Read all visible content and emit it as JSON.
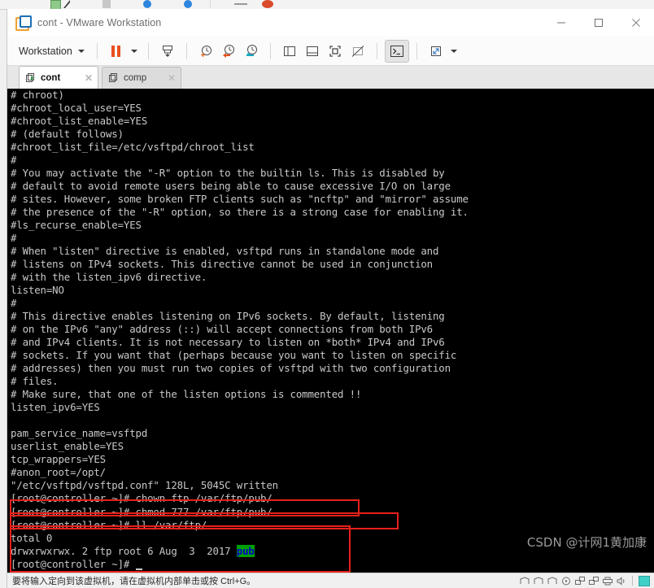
{
  "window": {
    "title": "cont - VMware Workstation",
    "app_icon": "vmware-logo-icon",
    "minimize_label": "Minimize",
    "maximize_label": "Maximize",
    "close_label": "Close"
  },
  "toolbar": {
    "menu_label": "Workstation",
    "items": [
      {
        "name": "pause-vm-button",
        "label": "Pause"
      },
      {
        "name": "pause-dropdown-button",
        "label": "Pause options"
      },
      {
        "name": "take-snapshot-button",
        "label": "Take snapshot"
      },
      {
        "name": "snapshot-manager-button",
        "label": "Snapshot"
      },
      {
        "name": "revert-snapshot-button",
        "label": "Revert to snapshot"
      },
      {
        "name": "manage-snapshots-button",
        "label": "Manage snapshots"
      },
      {
        "name": "show-library-button",
        "label": "Show or hide the library"
      },
      {
        "name": "show-console-view-button",
        "label": "Show or hide console view"
      },
      {
        "name": "show-thumbnails-button",
        "label": "Show or hide thumbnails"
      },
      {
        "name": "hide-thumbnails-button",
        "label": "Hide thumbnail bar"
      },
      {
        "name": "send-ctrl-alt-del-button",
        "label": "Send Ctrl+Alt+Del"
      },
      {
        "name": "fullscreen-button",
        "label": "Enter full screen"
      },
      {
        "name": "fullscreen-dropdown-button",
        "label": "Full screen options"
      }
    ]
  },
  "tabs": [
    {
      "label": "cont",
      "selected": true,
      "close_label": "✕",
      "icon": "vm-running-icon"
    },
    {
      "label": "comp",
      "selected": false,
      "close_label": "✕",
      "icon": "vm-stopped-icon"
    }
  ],
  "terminal": {
    "lines": [
      "# chroot)",
      "#chroot_local_user=YES",
      "#chroot_list_enable=YES",
      "# (default follows)",
      "#chroot_list_file=/etc/vsftpd/chroot_list",
      "#",
      "# You may activate the \"-R\" option to the builtin ls. This is disabled by",
      "# default to avoid remote users being able to cause excessive I/O on large",
      "# sites. However, some broken FTP clients such as \"ncftp\" and \"mirror\" assume",
      "# the presence of the \"-R\" option, so there is a strong case for enabling it.",
      "#ls_recurse_enable=YES",
      "#",
      "# When \"listen\" directive is enabled, vsftpd runs in standalone mode and",
      "# listens on IPv4 sockets. This directive cannot be used in conjunction",
      "# with the listen_ipv6 directive.",
      "listen=NO",
      "#",
      "# This directive enables listening on IPv6 sockets. By default, listening",
      "# on the IPv6 \"any\" address (::) will accept connections from both IPv6",
      "# and IPv4 clients. It is not necessary to listen on *both* IPv4 and IPv6",
      "# sockets. If you want that (perhaps because you want to listen on specific",
      "# addresses) then you must run two copies of vsftpd with two configuration",
      "# files.",
      "# Make sure, that one of the listen options is commented !!",
      "listen_ipv6=YES",
      "",
      "pam_service_name=vsftpd",
      "userlist_enable=YES",
      "tcp_wrappers=YES",
      "#anon_root=/opt/",
      "\"/etc/vsftpd/vsftpd.conf\" 128L, 5045C written"
    ],
    "commands": [
      "[root@controller ~]# chown ftp /var/ftp/pub/",
      "[root@controller ~]# chmod 777 /var/ftp/pub/",
      "[root@controller ~]# ll /var/ftp/",
      "total 0"
    ],
    "listing_prefix": "drwxrwxrwx. 2 ftp root 6 Aug  3  2017 ",
    "listing_highlight": "pub",
    "final_prompt": "[root@controller ~]# ",
    "colors": {
      "background": "#000000",
      "foreground": "#c9c9c9",
      "highlight_bg": "#00a000",
      "highlight_fg": "#0000cc",
      "annotation_red": "#e8201a"
    }
  },
  "annotations": [
    {
      "name": "highlight-box-chown"
    },
    {
      "name": "highlight-box-chmod"
    },
    {
      "name": "highlight-box-listing"
    }
  ],
  "watermark": {
    "text": "CSDN @计网1黄加康"
  },
  "statusbar": {
    "hint": "要将输入定向到该虚拟机，请在虚拟机内部单击或按 Ctrl+G。",
    "icons": [
      {
        "name": "hard-disk-icon"
      },
      {
        "name": "hard-disk-2-icon"
      },
      {
        "name": "hard-disk-3-icon"
      },
      {
        "name": "cd-dvd-icon"
      },
      {
        "name": "network-adapter-icon"
      },
      {
        "name": "network-adapter-2-icon"
      },
      {
        "name": "printer-icon"
      },
      {
        "name": "sound-card-icon"
      }
    ],
    "indicator": {
      "name": "vm-active-indicator",
      "color": "#3fd0c9"
    }
  }
}
